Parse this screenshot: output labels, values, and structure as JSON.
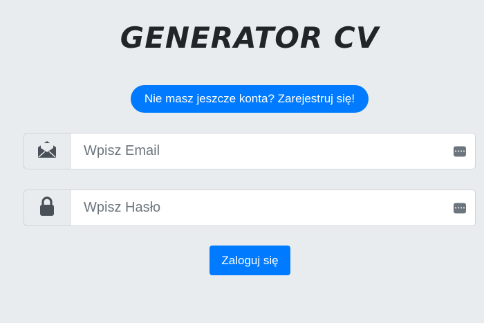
{
  "app": {
    "title": "GENERATOR CV"
  },
  "register_link": {
    "label": "Nie masz jeszcze konta? Zarejestruj się!"
  },
  "email_field": {
    "placeholder": "Wpisz Email",
    "value": "",
    "addon_icon": "envelope-icon",
    "autofill_icon": "password-manager-icon"
  },
  "password_field": {
    "placeholder": "Wpisz Hasło",
    "value": "",
    "addon_icon": "lock-icon",
    "autofill_icon": "password-manager-icon"
  },
  "login_button": {
    "label": "Zaloguj się"
  },
  "colors": {
    "background": "#e9ecef",
    "primary": "#007bff",
    "title_text": "#212529",
    "icon": "#495057"
  }
}
